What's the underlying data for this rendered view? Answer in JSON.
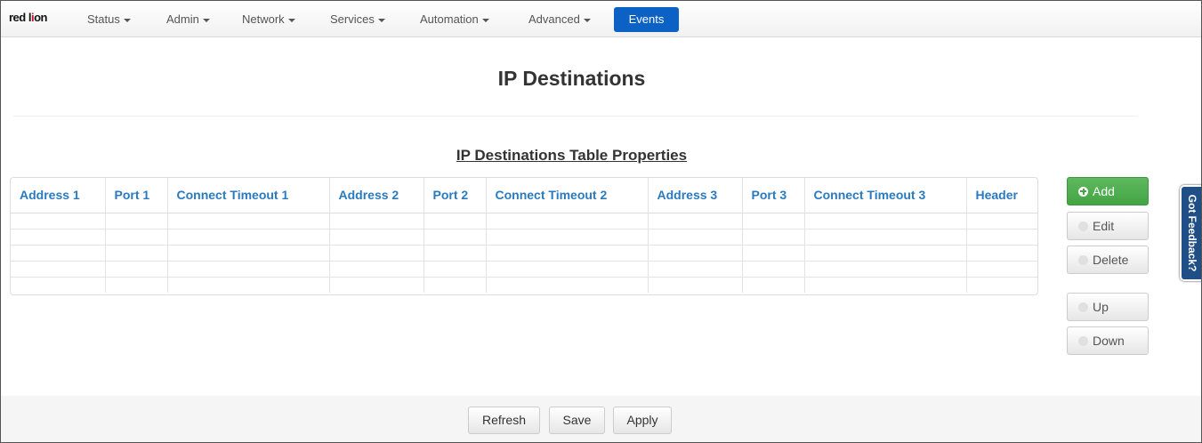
{
  "navbar": {
    "logo": {
      "word1": "red l",
      "o": "i",
      "word2": "on"
    },
    "items": [
      {
        "label": "Status"
      },
      {
        "label": "Admin"
      },
      {
        "label": "Network"
      },
      {
        "label": "Services"
      },
      {
        "label": "Automation"
      },
      {
        "label": "Advanced"
      }
    ],
    "active_item": "Events"
  },
  "page": {
    "title": "IP Destinations",
    "table_caption": "IP Destinations Table Properties"
  },
  "table": {
    "columns": [
      "Address 1",
      "Port 1",
      "Connect Timeout 1",
      "Address 2",
      "Port 2",
      "Connect Timeout 2",
      "Address 3",
      "Port 3",
      "Connect Timeout 3",
      "Header"
    ],
    "rows": 5
  },
  "side_buttons": {
    "add": "Add",
    "edit": "Edit",
    "delete": "Delete",
    "up": "Up",
    "down": "Down"
  },
  "feedback": {
    "label": "Got Feedback?"
  },
  "footer": {
    "refresh": "Refresh",
    "save": "Save",
    "apply": "Apply"
  },
  "colors": {
    "accent": "#0b62c4",
    "header_text": "#2a7abf",
    "add_button": "#43a543",
    "feedback_tab": "#1f4f86",
    "logo_red": "#c8102e"
  }
}
